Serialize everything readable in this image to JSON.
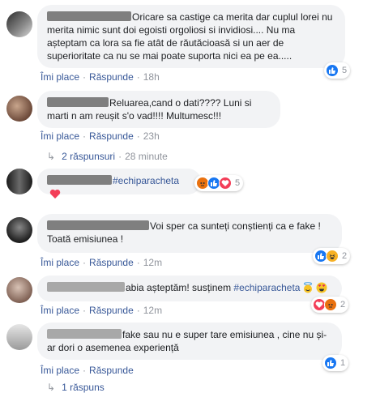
{
  "labels": {
    "like": "Îmi place",
    "reply": "Răspunde",
    "dot": "·"
  },
  "comments": [
    {
      "text": "Oricare sa castige ca merita dar cuplul lorei nu merita nimic sunt doi egoisti orgoliosi si invidiosi.... Nu ma așteptam ca lora sa fie atât de răutăcioasă si un aer de superioritate ca nu se mai poate suporta nici ea pe ea.....",
      "time": "18h",
      "reaction_count": "5",
      "reactions": [
        "like-icon"
      ]
    },
    {
      "text": "Reluarea,cand o dati???? Luni si marti n am reușit s'o vad!!!! Multumesc!!!",
      "time": "23h",
      "reaction_count": "",
      "reactions": [],
      "replies_label": "2 răspunsuri",
      "replies_time": "28 minute"
    },
    {
      "text": "#echiparacheta",
      "reaction_count": "5",
      "reactions": [
        "angry-icon",
        "like-icon",
        "love-icon"
      ]
    },
    {
      "text": "Voi sper ca sunteți conștienți ca e fake ! Toată emisiunea !",
      "time": "12m",
      "reaction_count": "2",
      "reactions": [
        "like-icon",
        "haha-icon"
      ]
    },
    {
      "text_prefix": "abia așteptăm! susținem ",
      "text_tag": "#echiparacheta",
      "time": "12m",
      "reaction_count": "2",
      "reactions": [
        "love-icon",
        "angry-icon"
      ]
    },
    {
      "text": "fake sau nu e super tare emisiunea , cine nu și-ar dori o asemenea experiență",
      "time": "",
      "reaction_count": "1",
      "reactions": [
        "like-icon"
      ],
      "replies_label": "1 răspuns"
    }
  ],
  "colors": {
    "link": "#385898",
    "bubble": "#f2f3f5",
    "meta": "#90949c",
    "like": "#1877f2",
    "love": "#f33e58"
  }
}
